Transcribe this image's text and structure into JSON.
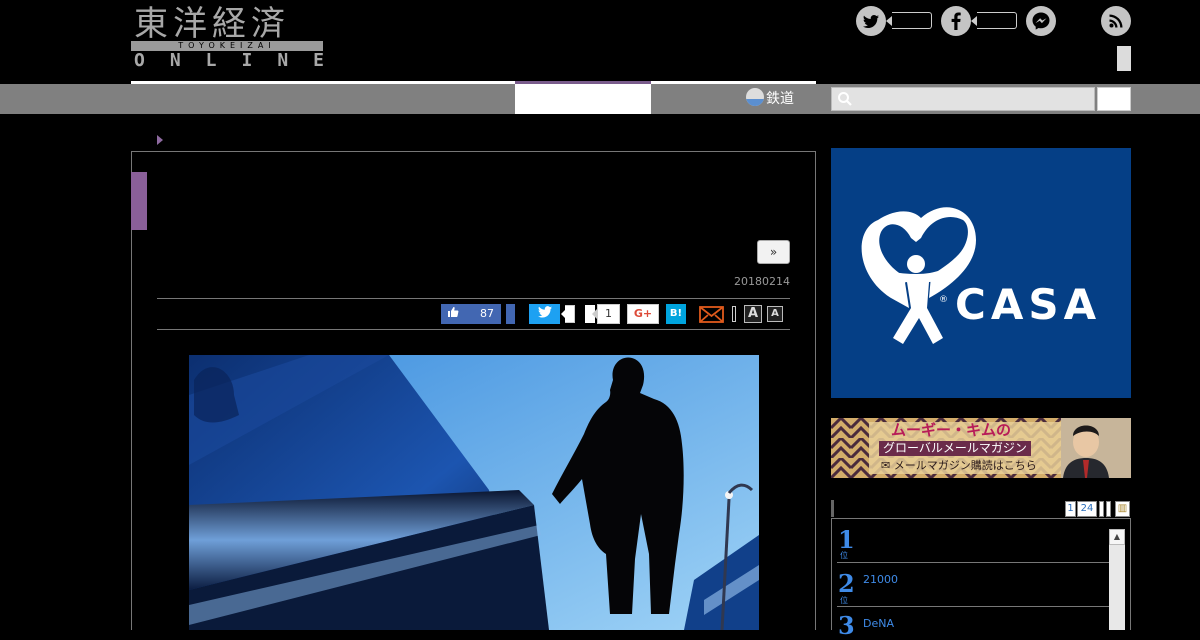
{
  "header": {
    "logo_kanji": "東洋経済",
    "logo_sub": "TOYOKEIZAI",
    "logo_online": "ONLINE",
    "social": [
      {
        "icon": "twitter-icon",
        "color": "#c4c4c4"
      },
      {
        "icon": "facebook-icon",
        "color": "#c4c4c4"
      },
      {
        "icon": "messenger-icon",
        "color": "#c4c4c4"
      },
      {
        "icon": "rss-icon",
        "color": "#c4c4c4"
      }
    ]
  },
  "nav": {
    "rail_label": "鉄道",
    "accent_color": "#7a5c8c"
  },
  "article": {
    "next_label": "»",
    "date": "20180214",
    "share": {
      "like_count": "87",
      "count_box": "1",
      "gplus_label": "G+",
      "hatena_label": "B!",
      "font_large": "A",
      "font_small": "A"
    },
    "photo_alt_icon": "escalator-photo"
  },
  "sidebar": {
    "ad1_brand": "CASA",
    "ad1_registered": "®",
    "ad1_bg": "#053f86",
    "ad2": {
      "title": "ムーギー・キムの",
      "subtitle": "グローバルメールマガジン",
      "cta": "メールマガジン購読はこちら"
    },
    "ranking": {
      "tabs": [
        "1",
        "24",
        "",
        "",
        "▥"
      ],
      "items": [
        {
          "rank": "1",
          "unit": "位",
          "text": ""
        },
        {
          "rank": "2",
          "unit": "位",
          "text": "21000"
        },
        {
          "rank": "3",
          "unit": "位",
          "text": "DeNA"
        }
      ],
      "scroll_up": "▲"
    }
  }
}
